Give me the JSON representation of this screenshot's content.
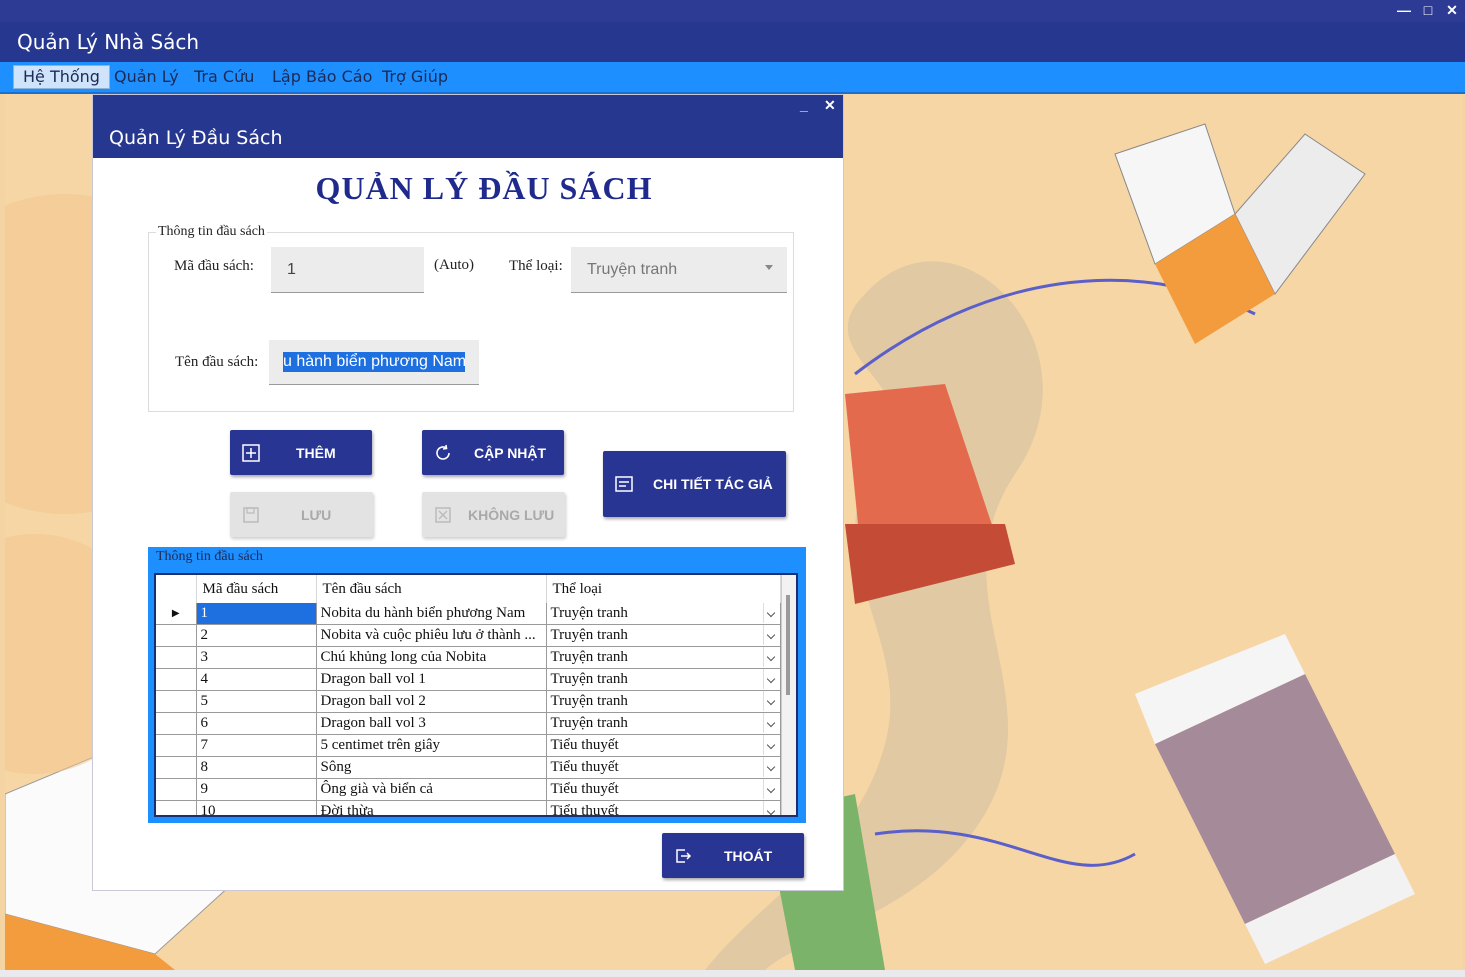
{
  "app": {
    "title": "Quản Lý Nhà Sách",
    "window_controls": {
      "minimize": "—",
      "maximize": "□",
      "close": "✕"
    }
  },
  "menu": {
    "items": [
      {
        "label": "Hệ Thống"
      },
      {
        "label": "Quản Lý"
      },
      {
        "label": "Tra Cứu"
      },
      {
        "label": "Lập Báo Cáo"
      },
      {
        "label": "Trợ Giúp"
      }
    ],
    "active_index": 0
  },
  "dialog": {
    "title": "Quản Lý Đầu Sách",
    "controls": {
      "minimize": "_",
      "close": "✕"
    },
    "heading": "QUẢN LÝ ĐẦU SÁCH",
    "info_group": {
      "legend": "Thông tin đầu sách",
      "ma_label": "Mã đầu sách:",
      "ma_value": "1",
      "auto_label": "(Auto)",
      "theloai_label": "Thể loại:",
      "theloai_value": "Truyện tranh",
      "ten_label": "Tên đầu sách:",
      "ten_value": "u hành biển phương Nam"
    },
    "buttons": {
      "them": "THÊM",
      "capnhat": "CẬP NHẬT",
      "chitiet": "CHI TIẾT TÁC GIẢ",
      "luu": "LƯU",
      "khongluu": "KHÔNG LƯU",
      "thoat": "THOÁT"
    },
    "grid_group": {
      "legend": "Thông tin đầu sách",
      "columns": [
        "Mã đầu sách",
        "Tên đầu sách",
        "Thể loại"
      ],
      "rows": [
        [
          "1",
          "Nobita du hành biển phương Nam",
          "Truyện tranh"
        ],
        [
          "2",
          "Nobita và cuộc phiêu lưu ở thành ...",
          "Truyện tranh"
        ],
        [
          "3",
          "Chú khủng long của Nobita",
          "Truyện tranh"
        ],
        [
          "4",
          "Dragon ball vol 1",
          "Truyện tranh"
        ],
        [
          "5",
          "Dragon ball vol 2",
          "Truyện tranh"
        ],
        [
          "6",
          "Dragon ball vol 3",
          "Truyện tranh"
        ],
        [
          "7",
          "5 centimet trên giây",
          "Tiểu thuyết"
        ],
        [
          "8",
          "Sông",
          "Tiểu thuyết"
        ],
        [
          "9",
          "Ông già và biển cả",
          "Tiểu thuyết"
        ],
        [
          "10",
          "Đời thừa",
          "Tiểu thuyết"
        ]
      ],
      "selected_row": 0
    }
  },
  "colors": {
    "title_bar": "#26378f",
    "menu_bar": "#1e8fff",
    "button": "#283593",
    "background": "#f7d6a6"
  }
}
